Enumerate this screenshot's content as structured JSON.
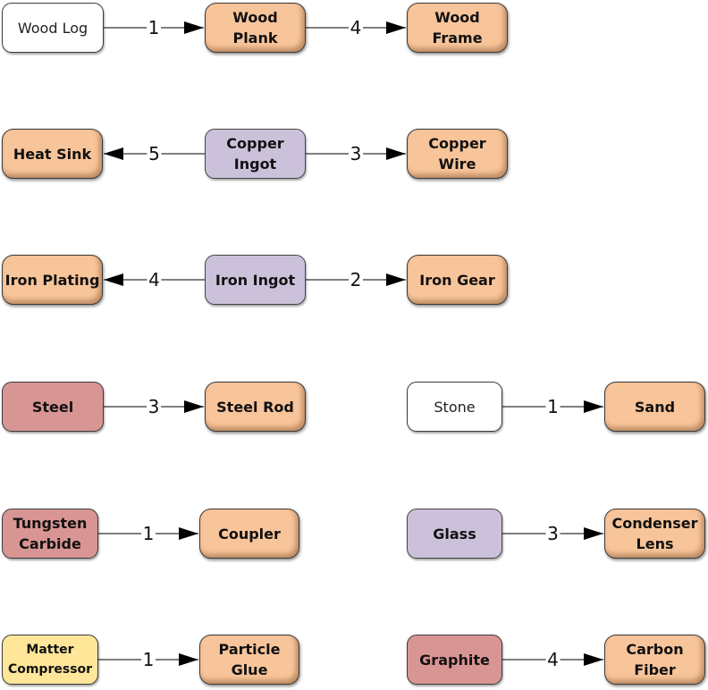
{
  "colors": {
    "raw": "#ffffff",
    "product": "#f8c49a",
    "ingot": "#ccc1da",
    "alloy": "#d99594",
    "special": "#ffe699"
  },
  "nodes": {
    "wood_log": {
      "lines": [
        "Wood Log"
      ],
      "kind": "raw"
    },
    "wood_plank": {
      "lines": [
        "Wood",
        "Plank"
      ],
      "kind": "product"
    },
    "wood_frame": {
      "lines": [
        "Wood",
        "Frame"
      ],
      "kind": "product"
    },
    "heat_sink": {
      "lines": [
        "Heat Sink"
      ],
      "kind": "product"
    },
    "copper_ingot": {
      "lines": [
        "Copper",
        "Ingot"
      ],
      "kind": "ingot"
    },
    "copper_wire": {
      "lines": [
        "Copper",
        "Wire"
      ],
      "kind": "product"
    },
    "iron_plating": {
      "lines": [
        "Iron Plating"
      ],
      "kind": "product"
    },
    "iron_ingot": {
      "lines": [
        "Iron Ingot"
      ],
      "kind": "ingot"
    },
    "iron_gear": {
      "lines": [
        "Iron Gear"
      ],
      "kind": "product"
    },
    "steel": {
      "lines": [
        "Steel"
      ],
      "kind": "alloy"
    },
    "steel_rod": {
      "lines": [
        "Steel Rod"
      ],
      "kind": "product"
    },
    "stone": {
      "lines": [
        "Stone"
      ],
      "kind": "raw"
    },
    "sand": {
      "lines": [
        "Sand"
      ],
      "kind": "product"
    },
    "tungsten_carbide": {
      "lines": [
        "Tungsten",
        "Carbide"
      ],
      "kind": "alloy"
    },
    "coupler": {
      "lines": [
        "Coupler"
      ],
      "kind": "product"
    },
    "glass": {
      "lines": [
        "Glass"
      ],
      "kind": "ingot"
    },
    "condenser_lens": {
      "lines": [
        "Condenser",
        "Lens"
      ],
      "kind": "product"
    },
    "matter_compressor": {
      "lines": [
        "Matter",
        "Compressor"
      ],
      "kind": "special"
    },
    "particle_glue": {
      "lines": [
        "Particle",
        "Glue"
      ],
      "kind": "product"
    },
    "graphite": {
      "lines": [
        "Graphite"
      ],
      "kind": "alloy"
    },
    "carbon_fiber": {
      "lines": [
        "Carbon",
        "Fiber"
      ],
      "kind": "product"
    }
  },
  "edges": [
    {
      "from": "wood_log",
      "to": "wood_plank",
      "label": "1"
    },
    {
      "from": "wood_plank",
      "to": "wood_frame",
      "label": "4"
    },
    {
      "from": "copper_ingot",
      "to": "heat_sink",
      "label": "5"
    },
    {
      "from": "copper_ingot",
      "to": "copper_wire",
      "label": "3"
    },
    {
      "from": "iron_ingot",
      "to": "iron_plating",
      "label": "4"
    },
    {
      "from": "iron_ingot",
      "to": "iron_gear",
      "label": "2"
    },
    {
      "from": "steel",
      "to": "steel_rod",
      "label": "3"
    },
    {
      "from": "stone",
      "to": "sand",
      "label": "1"
    },
    {
      "from": "tungsten_carbide",
      "to": "coupler",
      "label": "1"
    },
    {
      "from": "glass",
      "to": "condenser_lens",
      "label": "3"
    },
    {
      "from": "matter_compressor",
      "to": "particle_glue",
      "label": "1"
    },
    {
      "from": "graphite",
      "to": "carbon_fiber",
      "label": "4"
    }
  ]
}
